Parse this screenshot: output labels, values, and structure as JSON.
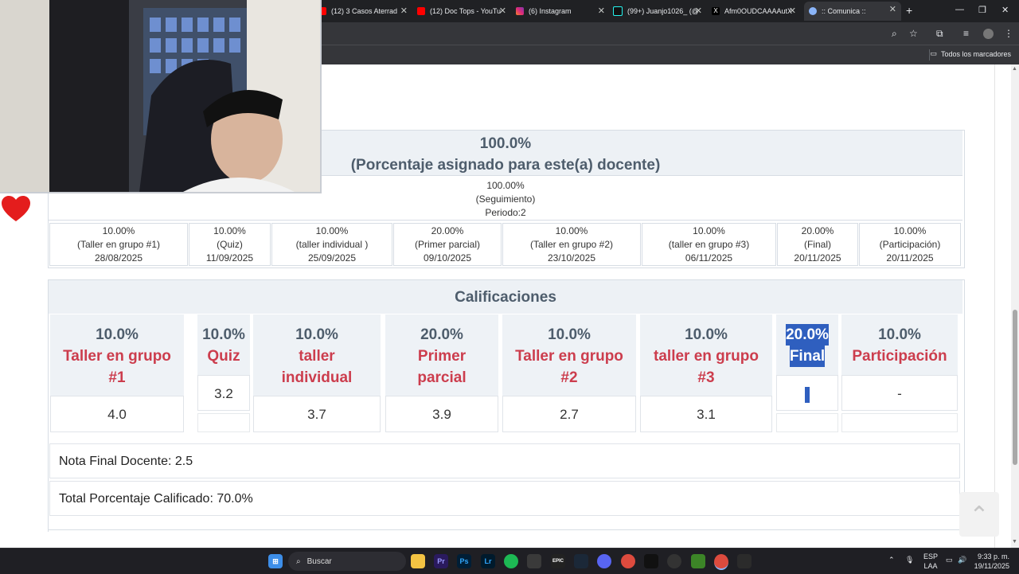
{
  "browser": {
    "tabs": [
      {
        "label": "(12) 3 Casos Aterrad",
        "icon": "youtube-icon",
        "active": false
      },
      {
        "label": "(12) Doc Tops - YouTu",
        "icon": "youtube-icon",
        "active": false
      },
      {
        "label": "(6) Instagram",
        "icon": "instagram-icon",
        "active": false
      },
      {
        "label": "(99+) Juanjo1026_ (@",
        "icon": "tiktok-icon",
        "active": false
      },
      {
        "label": "Afm0OUDCAAAAutX",
        "icon": "x-icon",
        "active": false
      },
      {
        "label": ":: Comunica ::",
        "icon": "globe-icon",
        "active": true
      }
    ],
    "bookmarks_all": "Todos los marcadores"
  },
  "header": {
    "percentage": "100.0%",
    "subtitle": "(Porcentaje asignado para este(a) docente)"
  },
  "seguimiento": {
    "percentage": "100.00%",
    "label": "(Seguimiento)",
    "period": "Periodo:2"
  },
  "evaluations": [
    {
      "pct": "10.00%",
      "name": "(Taller en grupo #1)",
      "date": "28/08/2025"
    },
    {
      "pct": "10.00%",
      "name": "(Quiz)",
      "date": "11/09/2025"
    },
    {
      "pct": "10.00%",
      "name": "(taller individual )",
      "date": "25/09/2025"
    },
    {
      "pct": "20.00%",
      "name": "(Primer parcial)",
      "date": "09/10/2025"
    },
    {
      "pct": "10.00%",
      "name": "(Taller en grupo #2)",
      "date": "23/10/2025"
    },
    {
      "pct": "10.00%",
      "name": "(taller en grupo #3)",
      "date": "06/11/2025"
    },
    {
      "pct": "20.00%",
      "name": "(Final)",
      "date": "20/11/2025"
    },
    {
      "pct": "10.00%",
      "name": "(Participación)",
      "date": "20/11/2025"
    }
  ],
  "calificaciones": {
    "title": "Calificaciones",
    "grades": [
      {
        "pct": "10.0%",
        "name": [
          "Taller en grupo",
          "#1"
        ],
        "value": "4.0"
      },
      {
        "pct": "10.0%",
        "name": [
          "Quiz"
        ],
        "value": "3.2"
      },
      {
        "pct": "10.0%",
        "name": [
          "taller",
          "individual"
        ],
        "value": "3.7"
      },
      {
        "pct": "20.0%",
        "name": [
          "Primer",
          "parcial"
        ],
        "value": "3.9"
      },
      {
        "pct": "10.0%",
        "name": [
          "Taller en grupo",
          "#2"
        ],
        "value": "2.7"
      },
      {
        "pct": "10.0%",
        "name": [
          "taller en grupo",
          "#3"
        ],
        "value": "3.1"
      },
      {
        "pct": "20.0%",
        "name": [
          "Final"
        ],
        "value": ""
      },
      {
        "pct": "10.0%",
        "name": [
          "Participación"
        ],
        "value": "-"
      }
    ]
  },
  "summary": {
    "nota_final": "Nota Final Docente:  2.5",
    "total": "Total Porcentaje Calificado: 70.0%"
  },
  "taskbar": {
    "search_placeholder": "Buscar",
    "lang": "ESP",
    "layout": "LAA",
    "time": "9:33 p. m.",
    "date": "19/11/2025"
  },
  "colors": {
    "accent_red": "#cc3d4d",
    "heading_slate": "#4e5d6c",
    "selection_blue": "#2f5fbf"
  }
}
